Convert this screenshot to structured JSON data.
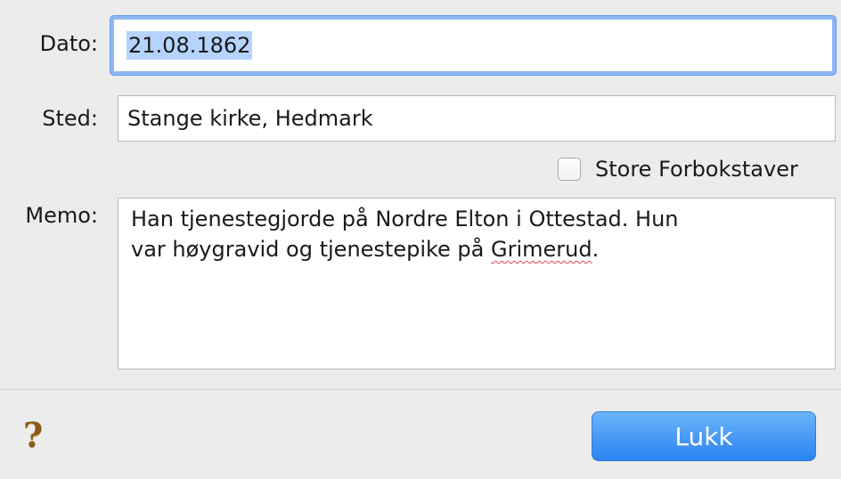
{
  "dato": {
    "label": "Dato:",
    "value": "21.08.1862"
  },
  "sted": {
    "label": "Sted:",
    "value": "Stange kirke, Hedmark"
  },
  "store_forbokstaver": {
    "label": "Store Forbokstaver",
    "checked": false
  },
  "memo": {
    "label": "Memo:",
    "line1": "Han tjenestegjorde på Nordre Elton i Ottestad. Hun",
    "line2_prefix": "var høygravid og tjenestepike på ",
    "line2_misspelled": "Grimerud",
    "line2_suffix": "."
  },
  "footer": {
    "help_icon": "question-mark-icon",
    "close_label": "Lukk"
  }
}
